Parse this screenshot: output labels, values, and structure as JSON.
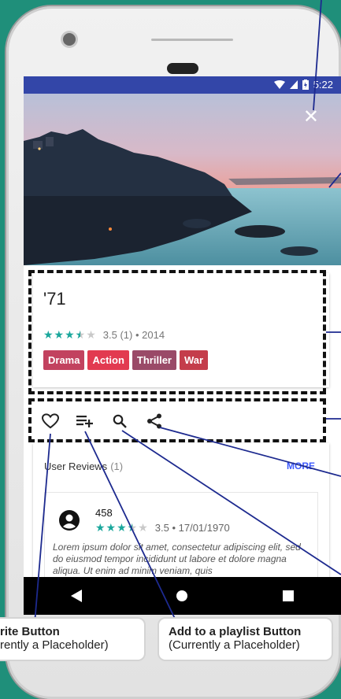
{
  "status": {
    "time": "5:22"
  },
  "movie": {
    "title": "'71",
    "rating_text": "3.5 (1) • 2014",
    "genres": [
      {
        "label": "Drama",
        "color": "#c2425f"
      },
      {
        "label": "Action",
        "color": "#e23a50"
      },
      {
        "label": "Thriller",
        "color": "#9a4a68"
      },
      {
        "label": "War",
        "color": "#c43d4b"
      }
    ]
  },
  "reviews": {
    "title": "User Reviews",
    "count": "(1)",
    "more_label": "MORE",
    "items": [
      {
        "user": "458",
        "meta": "3.5 • 17/01/1970",
        "text": "Lorem ipsum dolor sit amet, consectetur adipiscing elit, sed do eiusmod tempor incididunt ut labore et dolore magna aliqua. Ut enim ad minim veniam, quis"
      }
    ]
  },
  "callouts": {
    "favorite_title": "rite Button",
    "favorite_sub": "rently a Placeholder)",
    "playlist_title": "Add to a playlist Button",
    "playlist_sub": "(Currently a Placeholder)"
  },
  "colors": {
    "status_bar": "#3346a8",
    "accent": "#1aa79c",
    "link": "#3d5afe",
    "background": "#1f8f7a"
  }
}
